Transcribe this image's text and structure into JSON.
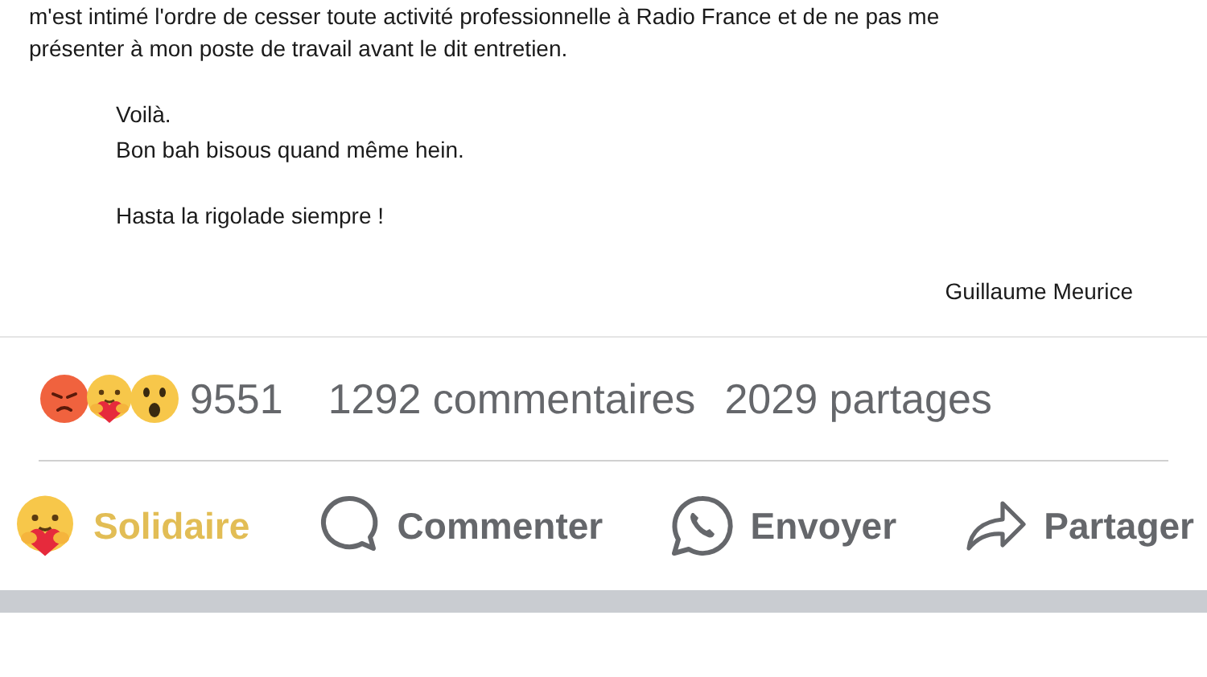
{
  "document": {
    "paragraph": [
      "m'est intimé l'ordre de cesser toute activité professionnelle à Radio France et de ne pas me",
      "présenter à mon poste de travail avant le dit entretien."
    ],
    "closing": [
      "Voilà.",
      "Bon bah bisous quand même hein."
    ],
    "motto": "Hasta la rigolade siempre !",
    "signature": "Guillaume Meurice"
  },
  "stats": {
    "reactions": [
      {
        "kind": "angry"
      },
      {
        "kind": "care"
      },
      {
        "kind": "wow"
      }
    ],
    "reaction_count": "9551",
    "comments": "1292 commentaires",
    "shares": "2029 partages"
  },
  "actions": [
    {
      "kind": "care",
      "label": "Solidaire",
      "selected": true
    },
    {
      "kind": "comment",
      "label": "Commenter",
      "selected": false
    },
    {
      "kind": "whatsapp",
      "label": "Envoyer",
      "selected": false
    },
    {
      "kind": "share",
      "label": "Partager",
      "selected": false
    }
  ]
}
